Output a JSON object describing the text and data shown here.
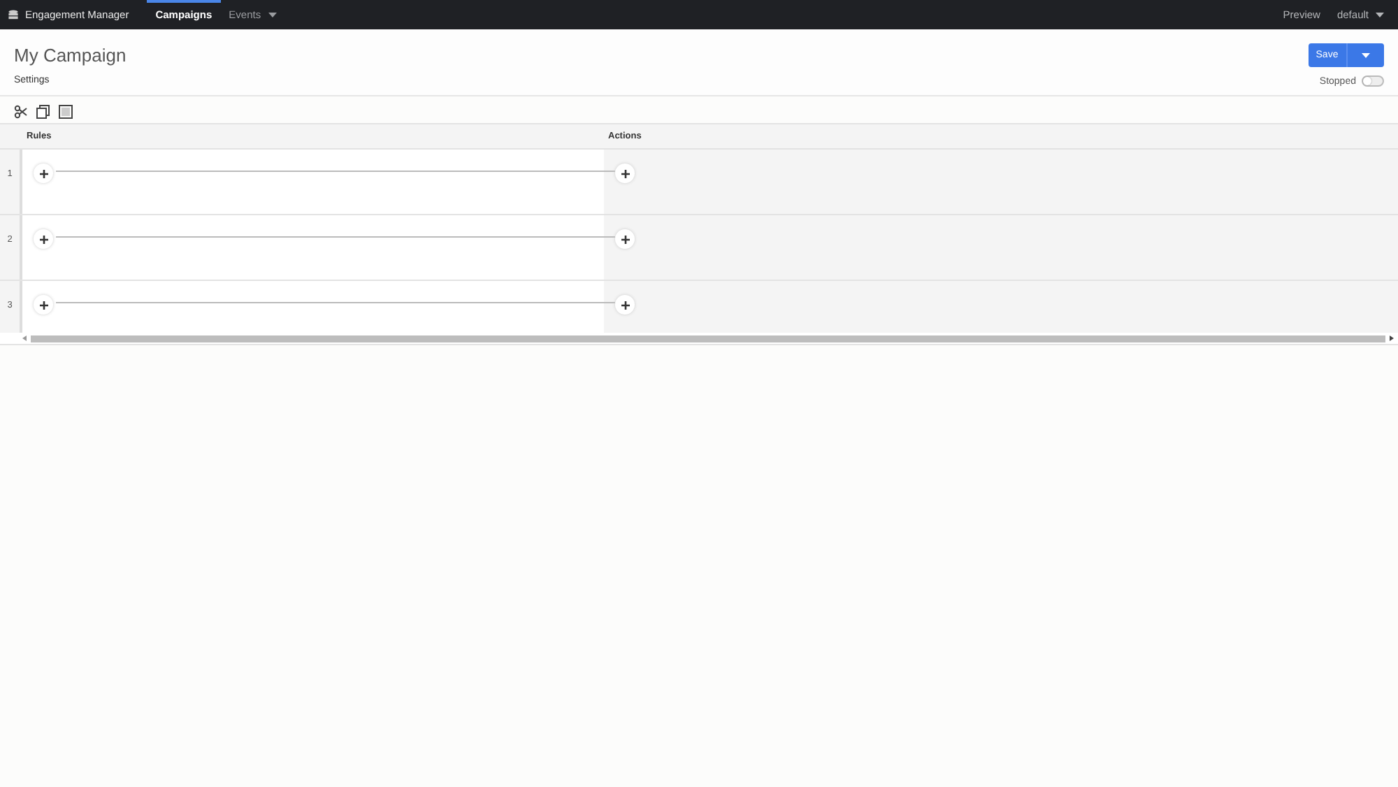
{
  "nav": {
    "brand": "Engagement Manager",
    "tabs": [
      {
        "label": "Campaigns",
        "selected": true,
        "dropdown": false
      },
      {
        "label": "Events",
        "selected": false,
        "dropdown": true
      }
    ],
    "right": [
      {
        "label": "Preview",
        "dropdown": false
      },
      {
        "label": "default",
        "dropdown": true
      }
    ]
  },
  "header": {
    "title": "My Campaign",
    "settings_link": "Settings",
    "save_button": "Save",
    "status": {
      "label": "Stopped",
      "on": false
    }
  },
  "toolbar": [
    {
      "kind": "cut"
    },
    {
      "kind": "copy"
    },
    {
      "kind": "paste"
    }
  ],
  "grid": {
    "columns": [
      "Rules",
      "Actions"
    ],
    "rows": [
      {
        "number": "1"
      },
      {
        "number": "2"
      },
      {
        "number": "3"
      }
    ]
  }
}
